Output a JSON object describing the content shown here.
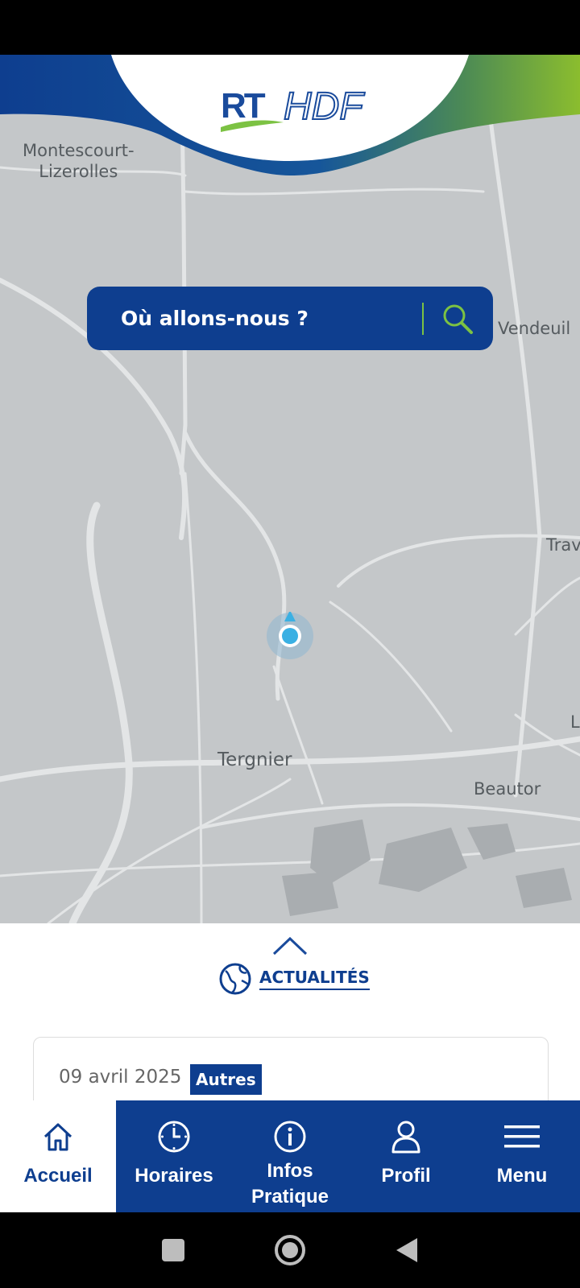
{
  "header": {
    "logo_alt": "RTHDF"
  },
  "map": {
    "labels": [
      {
        "text": "Montescourt-\nLizerolles"
      },
      {
        "text": "Vendeuil"
      },
      {
        "text": "Tergnier"
      },
      {
        "text": "Beautor"
      },
      {
        "text": "Trav"
      },
      {
        "text": "L"
      }
    ]
  },
  "search": {
    "placeholder": "Où allons-nous ?"
  },
  "news": {
    "label": "ACTUALITÉS",
    "card": {
      "date": "09 avril 2025",
      "tag": "Autres"
    }
  },
  "tabs": [
    {
      "label": "Accueil",
      "icon": "home-icon",
      "active": true
    },
    {
      "label": "Horaires",
      "icon": "clock-icon",
      "active": false
    },
    {
      "label": "Infos Pratique",
      "icon": "info-icon",
      "active": false
    },
    {
      "label": "Profil",
      "icon": "user-icon",
      "active": false
    },
    {
      "label": "Menu",
      "icon": "hamburger-icon",
      "active": false
    }
  ],
  "colors": {
    "brand_blue": "#0e3e8f",
    "brand_green": "#7cc243",
    "map_bg": "#c4c7c9",
    "location": "#3ab0e3"
  }
}
